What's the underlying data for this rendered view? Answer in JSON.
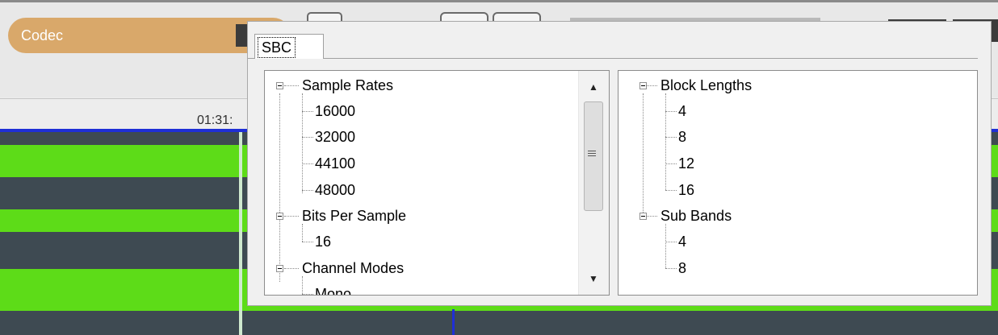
{
  "app": {
    "codec_label": "Codec",
    "timeline_time": "01:31:"
  },
  "dialog": {
    "tab_label": "SBC",
    "left_tree": {
      "sample_rates": {
        "label": "Sample Rates",
        "values": [
          "16000",
          "32000",
          "44100",
          "48000"
        ]
      },
      "bits_per_sample": {
        "label": "Bits Per Sample",
        "values": [
          "16"
        ]
      },
      "channel_modes": {
        "label": "Channel Modes",
        "values": [
          "Mono"
        ]
      }
    },
    "right_tree": {
      "block_lengths": {
        "label": "Block Lengths",
        "values": [
          "4",
          "8",
          "12",
          "16"
        ]
      },
      "sub_bands": {
        "label": "Sub Bands",
        "values": [
          "4",
          "8"
        ]
      }
    },
    "scrollbar": {
      "up_icon": "▲",
      "down_icon": "▼"
    }
  },
  "colors": {
    "waveform_green": "#5ddc18",
    "waveform_dark": "#3e4a52",
    "codec_pill": "#d9a86a",
    "timeline_blue": "#1f2fd6"
  }
}
